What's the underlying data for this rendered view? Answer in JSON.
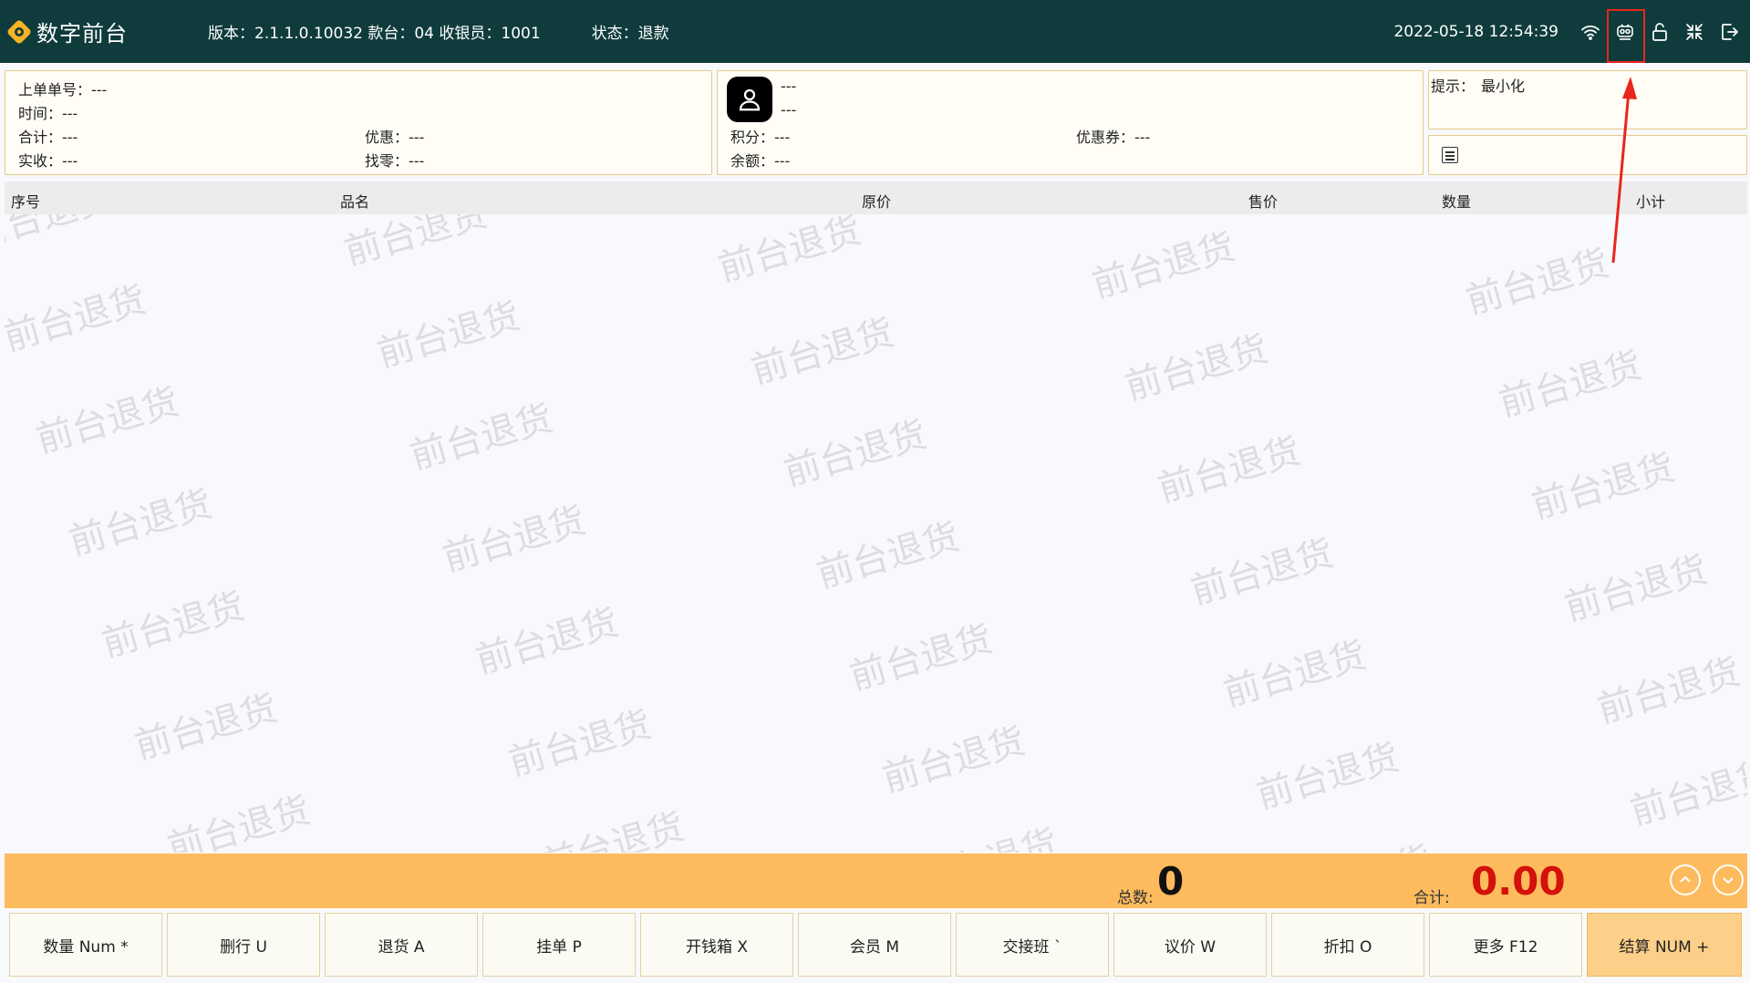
{
  "header": {
    "app_name": "数字前台",
    "info": "版本：2.1.1.0.10032 款台：04 收银员：1001",
    "status": "状态：退款",
    "datetime": "2022-05-18 12:54:39"
  },
  "order_panel": {
    "last_order": "上单单号：---",
    "time": "时间：---",
    "total": "合计：---",
    "discount": "优惠：---",
    "received": "实收：---",
    "change": "找零：---"
  },
  "member_panel": {
    "name": "---",
    "phone": "---",
    "points": "积分：---",
    "coupon": "优惠券：---",
    "balance": "余额：---"
  },
  "hint_panel": {
    "label": "提示：",
    "value": "最小化"
  },
  "table": {
    "columns": [
      "序号",
      "品名",
      "原价",
      "售价",
      "数量",
      "小计"
    ]
  },
  "watermark": "前台退货",
  "totals": {
    "count_label": "总数:",
    "count_value": "0",
    "sum_label": "合计:",
    "sum_value": "0.00"
  },
  "buttons": [
    "数量 Num *",
    "删行 U",
    "退货 A",
    "挂单 P",
    "开钱箱 X",
    "会员 M",
    "交接班 `",
    "议价 W",
    "折扣 O",
    "更多 F12",
    "结算 NUM +"
  ],
  "colors": {
    "header_bg": "#0f3b3c",
    "totals_bg": "#fdbb5e",
    "sum_color": "#d4110b",
    "annotation": "#e8261d"
  }
}
